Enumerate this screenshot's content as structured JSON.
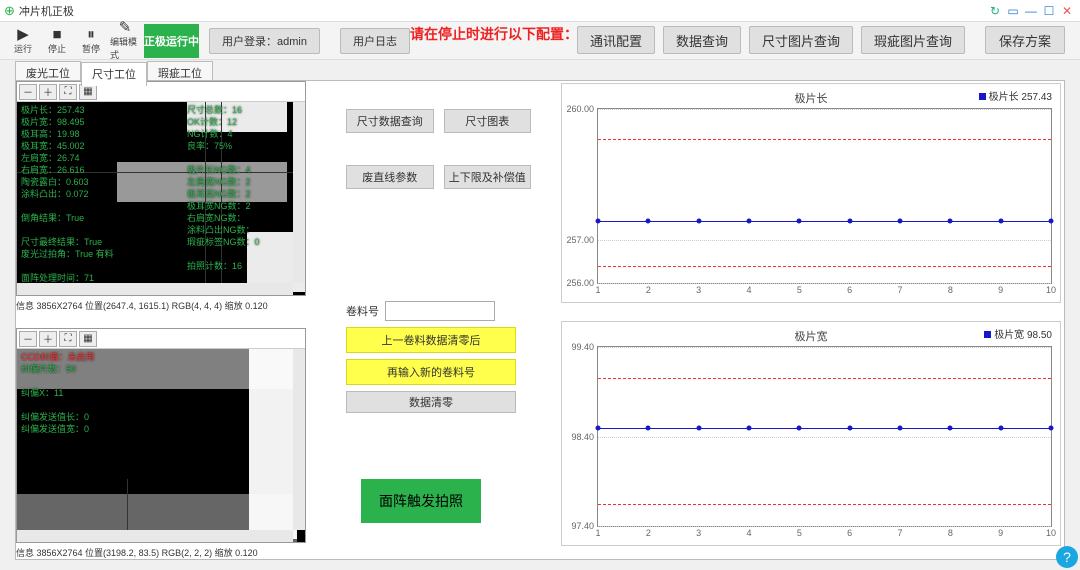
{
  "window": {
    "title": "冲片机正极",
    "icon": "⊕"
  },
  "toolbar": {
    "run": "运行",
    "stop": "停止",
    "pause": "暂停",
    "edit_mode": "编辑模式",
    "run_badge": "正极运行中",
    "user_login": "用户登录：admin",
    "user_log": "用户日志"
  },
  "banner": "请在停止时进行以下配置：",
  "right_btns": {
    "comm_cfg": "通讯配置",
    "data_query": "数据查询",
    "size_img_query": "尺寸图片查询",
    "defect_img_query": "瑕疵图片查询",
    "save_scheme": "保存方案"
  },
  "tabs": {
    "t1": "废光工位",
    "t2": "尺寸工位",
    "t3": "瑕疵工位"
  },
  "viewer_buttons": {
    "zoom_out": "⌕",
    "zoom_in": "⌕",
    "fit": "⛶",
    "actual": "▦"
  },
  "viewer_top_overlay": "极片长：257.43\n极片宽：98.495\n极耳高：19.98\n极耳宽：45.002\n左肩宽：26.74\n右肩宽：26.616\n陶瓷露白：0.603\n涂料凸出：0.072\n\n倒角结果：True\n\n尺寸最终结果：True\n废光过拍角：True 有料\n\n面阵处理时间：71",
  "viewer_top_overlay_right": "尺寸总数：16\nOK计数：12\nNG计数：4\n良率：75%\n\n极片长NG数：4\n左肩宽NG数：2\n极耳高NG数：2\n极耳宽NG数：2\n右肩宽NG数：\n涂料凸出NG数：\n瑕疵标签NG数：0\n\n拍照计数：16",
  "viewer_top_info": "信息 3856X2764 位置(2647.4, 1615.1) RGB(4, 4, 4) 缩放 0.120",
  "viewer_bot_overlay_line1": "CCD纠偏：未启用",
  "viewer_bot_overlay": "纠偏片数：50\n\n纠偏X：11\n\n纠偏发送值长：0\n纠偏发送值宽：0",
  "viewer_bot_info": "信息 3856X2764 位置(3198.2, 83.5) RGB(2, 2, 2) 缩放 0.120",
  "mid": {
    "btn_size_query": "尺寸数据查询",
    "btn_size_chart": "尺寸图表",
    "btn_line_params": "废直线参数",
    "btn_limits": "上下限及补偿值",
    "roll_label": "卷料号",
    "yellow1": "上一卷料数据清零后",
    "yellow2": "再输入新的卷料号",
    "clear": "数据清零",
    "green_big": "面阵触发拍照"
  },
  "chart_data": [
    {
      "type": "line",
      "title": "极片长",
      "legend": "极片长",
      "legend_value": "257.43",
      "ylim": [
        256.0,
        260.0
      ],
      "yticks": [
        256.0,
        257.0,
        260.0
      ],
      "x": [
        1,
        2,
        3,
        4,
        5,
        6,
        7,
        8,
        9,
        10
      ],
      "value": 257.43,
      "upper": 259.3,
      "lower": 256.4
    },
    {
      "type": "line",
      "title": "极片宽",
      "legend": "极片宽",
      "legend_value": "98.50",
      "ylim": [
        97.4,
        99.4
      ],
      "yticks": [
        97.4,
        98.4,
        99.4
      ],
      "x": [
        1,
        2,
        3,
        4,
        5,
        6,
        7,
        8,
        9,
        10
      ],
      "value": 98.5,
      "upper": 99.05,
      "lower": 97.65
    }
  ]
}
